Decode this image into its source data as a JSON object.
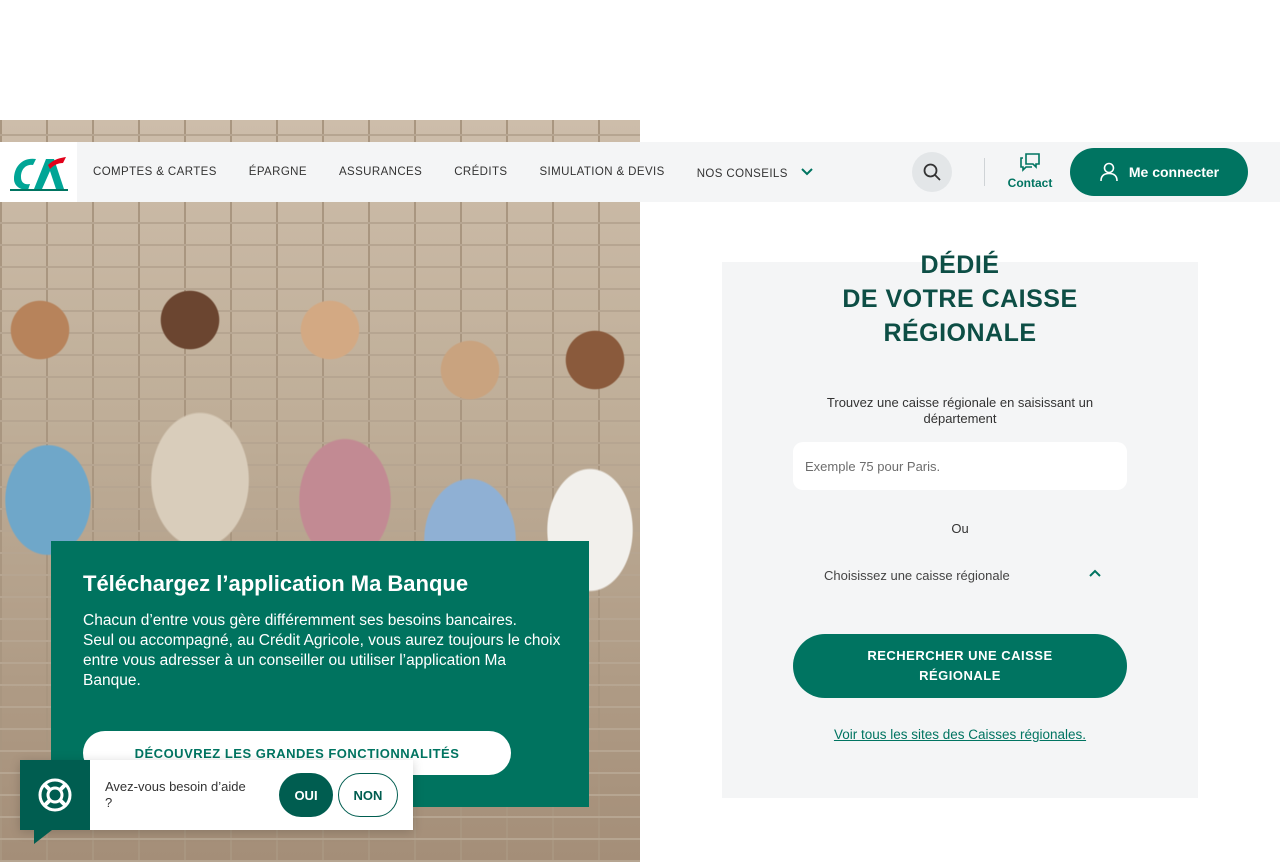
{
  "header": {
    "nav": [
      {
        "label": "COMPTES & CARTES"
      },
      {
        "label": "ÉPARGNE"
      },
      {
        "label": "ASSURANCES"
      },
      {
        "label": "CRÉDITS"
      },
      {
        "label": "SIMULATION & DEVIS"
      },
      {
        "label": "NOS CONSEILS"
      }
    ],
    "contact_label": "Contact",
    "connect_label": "Me connecter",
    "icons": {
      "logo": "credit-agricole-logo",
      "search": "search-icon",
      "contact": "chat-bubbles-icon",
      "user": "user-icon",
      "chevron": "chevron-down-icon"
    }
  },
  "card": {
    "title_lines": [
      "DÉDIÉ",
      "DE VOTRE CAISSE",
      "RÉGIONALE"
    ],
    "input_label": "Trouvez une caisse régionale en saisissant un département",
    "input_placeholder": "Exemple 75 pour Paris.",
    "or_label": "Ou",
    "select_label": "Choisissez une caisse régionale",
    "search_button": "RECHERCHER UNE CAISSE RÉGIONALE",
    "all_sites_link": "Voir tous les sites des Caisses régionales."
  },
  "promo": {
    "title": "Téléchargez l’application Ma Banque",
    "text_1": "Chacun d’entre vous gère différemment ses besoins bancaires.",
    "text_2": "Seul ou accompagné, au Crédit Agricole, vous aurez toujours le choix entre vous adresser à un conseiller ou utiliser l’application Ma Banque.",
    "button": "DÉCOUVREZ LES GRANDES FONCTIONNALITÉS"
  },
  "help": {
    "question": "Avez-vous besoin d’aide ?",
    "yes": "OUI",
    "no": "NON",
    "icon": "lifebuoy-icon"
  },
  "colors": {
    "brand_green": "#007461",
    "dark_green": "#005d50",
    "title_green": "#0d4e45",
    "header_bg": "#f4f5f6"
  }
}
